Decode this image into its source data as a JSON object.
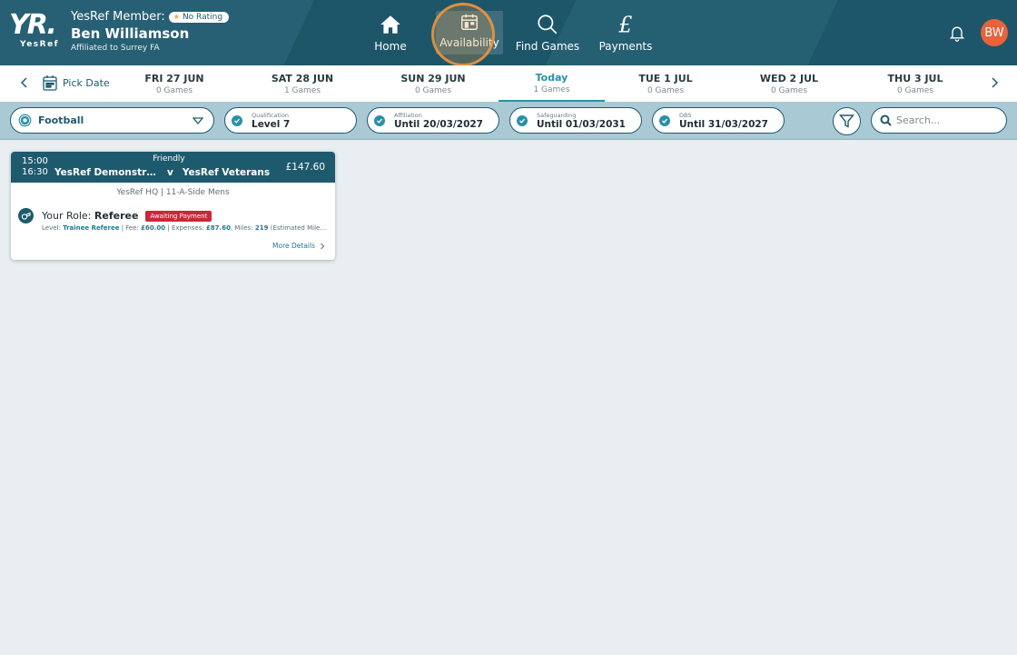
{
  "header": {
    "logo_text": "YR.",
    "logo_sub": "YesRef",
    "member_label": "YesRef Member:",
    "rating_badge": "No Rating",
    "member_name": "Ben Williamson",
    "affiliation": "Affiliated to Surrey FA",
    "avatar_initials": "BW",
    "nav": [
      {
        "label": "Home",
        "icon": "home-icon"
      },
      {
        "label": "Availability",
        "icon": "calendar-icon"
      },
      {
        "label": "Find Games",
        "icon": "search-icon"
      },
      {
        "label": "Payments",
        "icon": "pound-icon"
      }
    ]
  },
  "datebar": {
    "pick_date_label": "Pick Date",
    "days": [
      {
        "name": "FRI 27 JUN",
        "count": "0 Games"
      },
      {
        "name": "SAT 28 JUN",
        "count": "1 Games"
      },
      {
        "name": "SUN 29 JUN",
        "count": "0 Games"
      },
      {
        "name": "Today",
        "count": "1 Games"
      },
      {
        "name": "TUE 1 JUL",
        "count": "0 Games"
      },
      {
        "name": "WED 2 JUL",
        "count": "0 Games"
      },
      {
        "name": "THU 3 JUL",
        "count": "0 Games"
      }
    ]
  },
  "filters": {
    "sport": "Football",
    "credentials": [
      {
        "label": "Qualification",
        "value": "Level 7"
      },
      {
        "label": "Affiliation",
        "value": "Until 20/03/2027"
      },
      {
        "label": "Safeguarding",
        "value": "Until 01/03/2031"
      },
      {
        "label": "DBS",
        "value": "Until 31/03/2027"
      }
    ],
    "search_placeholder": "Search..."
  },
  "game": {
    "start": "15:00",
    "end": "16:30",
    "match_type": "Friendly",
    "home_team": "YesRef Demonstrati...",
    "vs": "v",
    "away_team": "YesRef Veterans",
    "price": "£147.60",
    "venue": "YesRef HQ | 11-A-Side Mens",
    "role_label": "Your Role:",
    "role": "Referee",
    "status": "Awaiting Payment",
    "level_label": "Level:",
    "level": "Trainee Referee",
    "fee_label": "Fee:",
    "fee": "£60.00",
    "expenses_label": "Expenses:",
    "expenses": "£87.60",
    "miles_label": "Miles:",
    "miles": "219",
    "estimated": "(Estimated Miles: ...",
    "more_details": "More Details"
  },
  "colors": {
    "brand": "#1e5a6e",
    "accent": "#2a8fa8",
    "avatar": "#e8623a",
    "status": "#c8283a"
  }
}
